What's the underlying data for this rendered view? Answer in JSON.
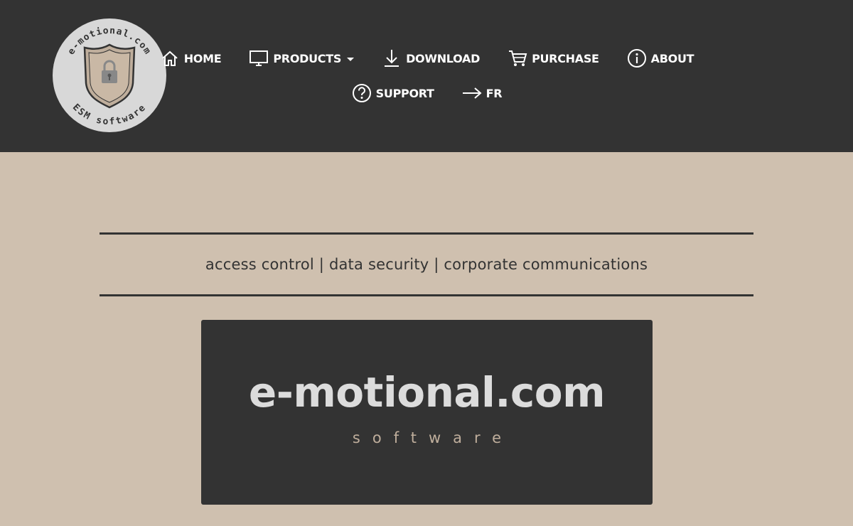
{
  "header": {
    "logo": {
      "ring_top_text": "e-motional.com",
      "ring_bottom_text": "ESM software",
      "icon": "shield-lock-icon"
    },
    "nav_row1": [
      {
        "label": "HOME",
        "icon": "home-icon"
      },
      {
        "label": "PRODUCTS",
        "icon": "monitor-icon",
        "has_dropdown": true
      },
      {
        "label": "DOWNLOAD",
        "icon": "download-icon"
      },
      {
        "label": "PURCHASE",
        "icon": "cart-icon"
      },
      {
        "label": "ABOUT",
        "icon": "info-icon"
      }
    ],
    "nav_row2": [
      {
        "label": "SUPPORT",
        "icon": "help-icon"
      },
      {
        "label": "FR",
        "icon": "arrow-right-icon"
      }
    ]
  },
  "main": {
    "tagline": "access control | data security | corporate communications",
    "banner": {
      "title": "e-motional.com",
      "subtitle": "software"
    }
  },
  "colors": {
    "header_bg": "#333333",
    "page_bg": "#cfc0af",
    "accent": "#bfae9c"
  }
}
